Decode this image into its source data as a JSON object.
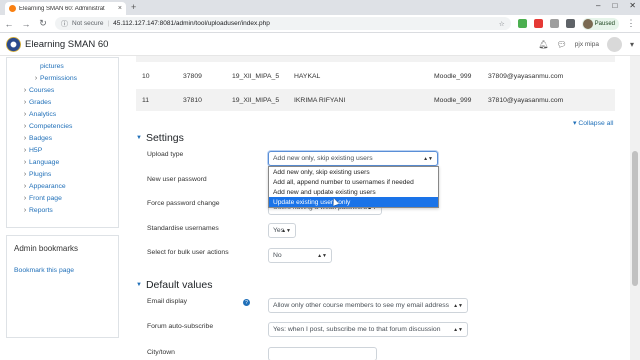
{
  "browser": {
    "tab_title": "Elearning SMAN 60: Administrat",
    "tab_close": "×",
    "new_tab": "+",
    "window_buttons": [
      "–",
      "□",
      "✕"
    ],
    "not_secure": "Not secure",
    "url": "45.112.127.147:8081/admin/tool/uploaduser/index.php",
    "profile_status": "Paused"
  },
  "navbar": {
    "site_name": "Elearning SMAN 60",
    "user_name": "pjx mipa"
  },
  "sidebar": {
    "items": [
      {
        "label": "pictures",
        "indent": 2,
        "arrow": false
      },
      {
        "label": "Permissions",
        "indent": 2,
        "arrow": true
      },
      {
        "label": "Courses",
        "indent": 1,
        "arrow": true
      },
      {
        "label": "Grades",
        "indent": 1,
        "arrow": true
      },
      {
        "label": "Analytics",
        "indent": 1,
        "arrow": true
      },
      {
        "label": "Competencies",
        "indent": 1,
        "arrow": true
      },
      {
        "label": "Badges",
        "indent": 1,
        "arrow": true
      },
      {
        "label": "H5P",
        "indent": 1,
        "arrow": true
      },
      {
        "label": "Language",
        "indent": 1,
        "arrow": true
      },
      {
        "label": "Plugins",
        "indent": 1,
        "arrow": true
      },
      {
        "label": "Appearance",
        "indent": 1,
        "arrow": true
      },
      {
        "label": "Front page",
        "indent": 1,
        "arrow": true
      },
      {
        "label": "Reports",
        "indent": 1,
        "arrow": true
      }
    ],
    "bookmarks_heading": "Admin bookmarks",
    "bookmark_link": "Bookmark this page"
  },
  "preview_table": {
    "rows": [
      {
        "num": "10",
        "id": "37809",
        "cls": "19_XII_MIPA_5",
        "name": "HAYKAL",
        "pass": "Moodle_999",
        "email": "37809@yayasanmu.com"
      },
      {
        "num": "11",
        "id": "37810",
        "cls": "19_XII_MIPA_5",
        "name": "IKRIMA RIFYANI",
        "pass": "Moodle_999",
        "email": "37810@yayasanmu.com"
      }
    ]
  },
  "collapse_all": "Collapse all",
  "settings": {
    "heading": "Settings",
    "upload_type_label": "Upload type",
    "upload_type_value": "Add new only, skip existing users",
    "upload_type_options": [
      "Add new only, skip existing users",
      "Add all, append number to usernames if needed",
      "Add new and update existing users",
      "Update existing users only"
    ],
    "highlighted_option_index": 3,
    "new_user_password_label": "New user password",
    "force_password_change_label": "Force password change",
    "force_password_change_value": "Users having a weak password",
    "standardise_usernames_label": "Standardise usernames",
    "standardise_usernames_value": "Yes",
    "bulk_actions_label": "Select for bulk user actions",
    "bulk_actions_value": "No"
  },
  "defaults": {
    "heading": "Default values",
    "email_display_label": "Email display",
    "email_display_value": "Allow only other course members to see my email address",
    "forum_subscribe_label": "Forum auto-subscribe",
    "forum_subscribe_value": "Yes: when I post, subscribe me to that forum discussion",
    "city_label": "City/town"
  },
  "colors": {
    "link": "#1f6fb8",
    "highlight": "#1a73e8",
    "paused_bg": "#e6f4ea"
  }
}
